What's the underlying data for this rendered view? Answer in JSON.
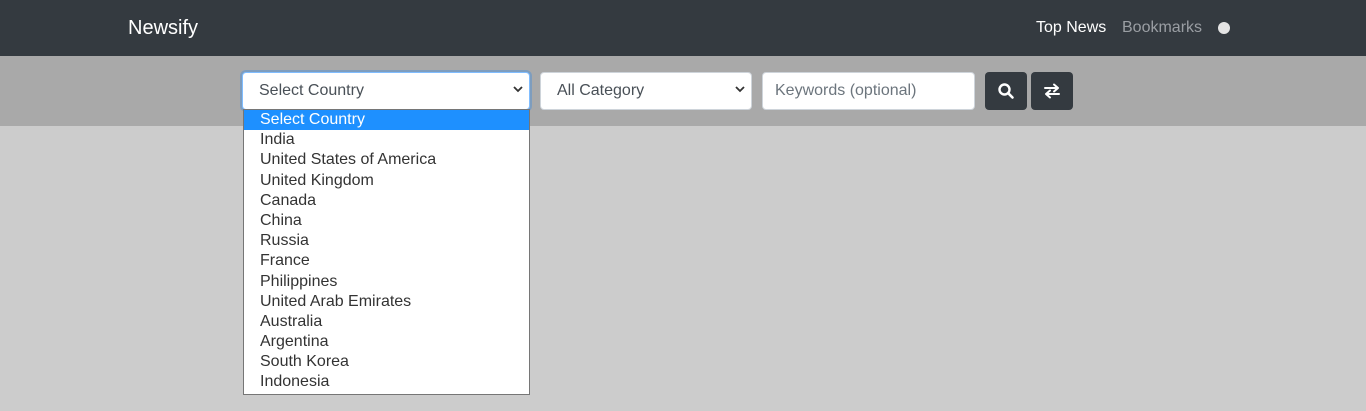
{
  "navbar": {
    "brand": "Newsify",
    "links": [
      "Top News",
      "Bookmarks"
    ]
  },
  "filters": {
    "country_select": {
      "value": "Select Country",
      "options": [
        "Select Country",
        "India",
        "United States of America",
        "United Kingdom",
        "Canada",
        "China",
        "Russia",
        "France",
        "Philippines",
        "United Arab Emirates",
        "Australia",
        "Argentina",
        "South Korea",
        "Indonesia"
      ],
      "highlighted": "Select Country"
    },
    "category_select": {
      "value": "All Category"
    },
    "keywords": {
      "placeholder": "Keywords (optional)"
    }
  },
  "icons": {
    "search_button": "search-icon",
    "swap_button": "swap-icon",
    "theme_toggle": "circle-toggle-icon"
  }
}
